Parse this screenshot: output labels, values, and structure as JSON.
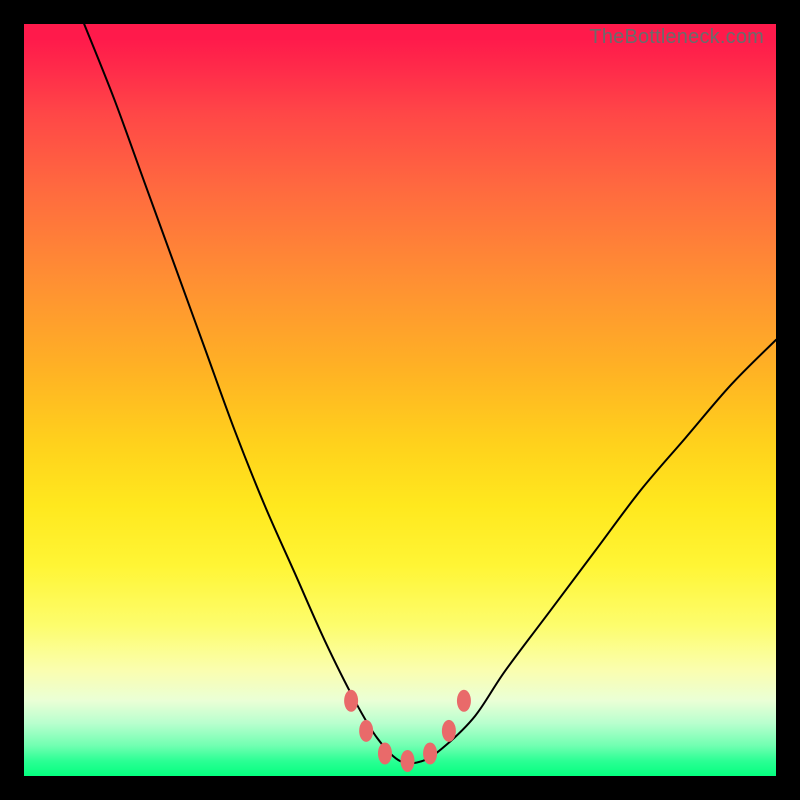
{
  "watermark": "TheBottleneck.com",
  "chart_data": {
    "type": "line",
    "title": "",
    "xlabel": "",
    "ylabel": "",
    "xlim": [
      0,
      100
    ],
    "ylim": [
      0,
      100
    ],
    "grid": false,
    "legend": false,
    "background_gradient": {
      "top": "#ff1a4b",
      "mid": "#ffe81e",
      "bottom": "#04ff7f"
    },
    "series": [
      {
        "name": "bottleneck-curve",
        "color": "#000000",
        "x": [
          8,
          12,
          16,
          20,
          24,
          28,
          32,
          36,
          40,
          44,
          47,
          50,
          53,
          56,
          60,
          64,
          70,
          76,
          82,
          88,
          94,
          100
        ],
        "y": [
          100,
          90,
          79,
          68,
          57,
          46,
          36,
          27,
          18,
          10,
          5,
          2,
          2,
          4,
          8,
          14,
          22,
          30,
          38,
          45,
          52,
          58
        ]
      }
    ],
    "markers": [
      {
        "name": "bottleneck-region-markers",
        "color": "#e96a6a",
        "x": [
          43.5,
          45.5,
          48,
          51,
          54,
          56.5,
          58.5
        ],
        "y": [
          10,
          6,
          3,
          2,
          3,
          6,
          10
        ]
      }
    ]
  }
}
